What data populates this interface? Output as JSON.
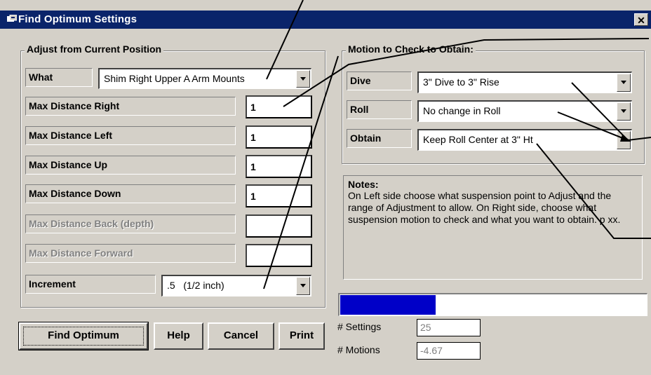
{
  "window": {
    "title": "Find Optimum Settings",
    "close_glyph": "✕"
  },
  "adjust": {
    "group_label": "Adjust from Current Position",
    "what_label": "What",
    "what_value": "Shim Right Upper A Arm Mounts",
    "rows": [
      {
        "label": "Max Distance Right",
        "value": "1",
        "enabled": true
      },
      {
        "label": "Max Distance Left",
        "value": "1",
        "enabled": true
      },
      {
        "label": "Max Distance Up",
        "value": "1",
        "enabled": true
      },
      {
        "label": "Max Distance Down",
        "value": "1",
        "enabled": true
      },
      {
        "label": "Max Distance Back (depth)",
        "value": "",
        "enabled": false
      },
      {
        "label": "Max Distance Forward",
        "value": "",
        "enabled": false
      }
    ],
    "increment_label": "Increment",
    "increment_value": ".5   (1/2 inch)"
  },
  "motion": {
    "group_label": "Motion to Check to Obtain:",
    "rows": [
      {
        "label": "Dive",
        "value": "3\" Dive to 3\" Rise"
      },
      {
        "label": "Roll",
        "value": "No change in Roll"
      },
      {
        "label": "Obtain",
        "value": "Keep Roll Center at 3\" Ht"
      }
    ]
  },
  "notes": {
    "title": "Notes:",
    "text": "On Left side choose what suspension point to Adjust and the range of Adjustment to allow.  On Right side, choose what suspension motion to check and what you want to obtain.  p xx."
  },
  "progress": {
    "fraction": 0.31,
    "color": "#0000c8"
  },
  "stats": {
    "settings_label": "# Settings",
    "settings_value": "25",
    "motions_label": "# Motions",
    "motions_value": "-4.67"
  },
  "buttons": {
    "find_optimum": "Find Optimum",
    "help": "Help",
    "cancel": "Cancel",
    "print": "Print"
  },
  "colors": {
    "titlebar": "#0a246a",
    "face": "#d4d0c8"
  }
}
